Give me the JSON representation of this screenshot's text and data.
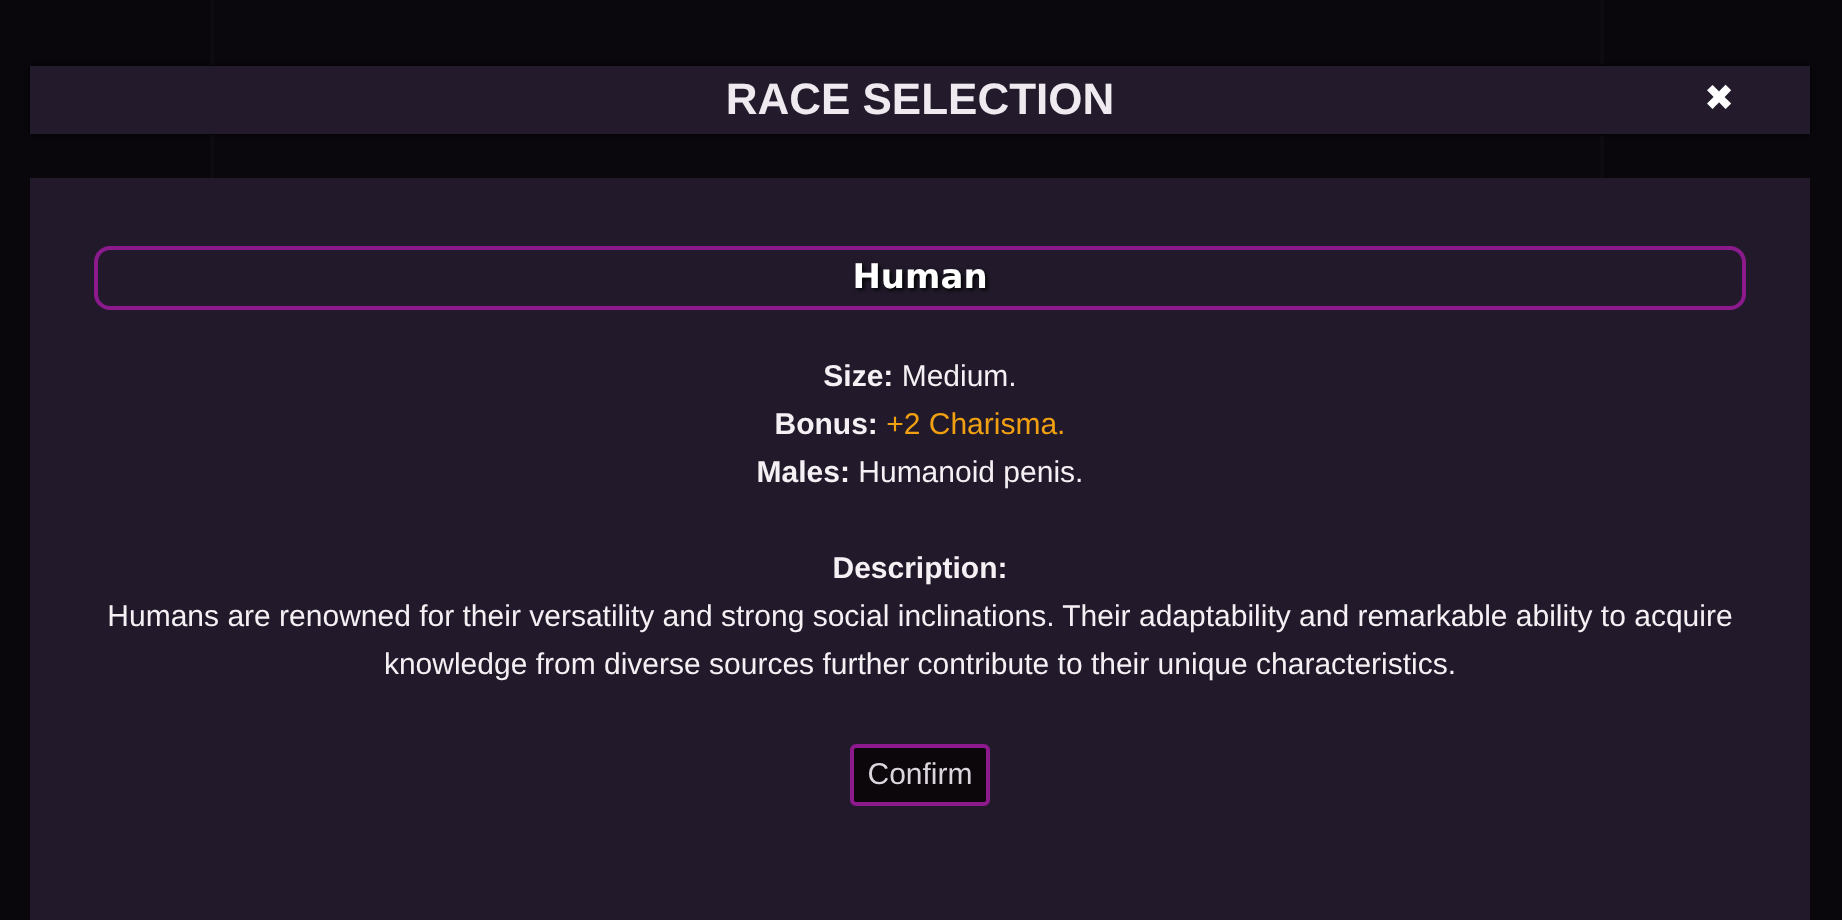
{
  "dialog": {
    "title": "RACE SELECTION",
    "close": "✖"
  },
  "race": {
    "name": "Human",
    "stats": [
      {
        "label": "Size:",
        "value": "Medium.",
        "highlight": false
      },
      {
        "label": "Bonus:",
        "value": "+2 Charisma.",
        "highlight": true
      },
      {
        "label": "Males:",
        "value": "Humanoid penis.",
        "highlight": false
      }
    ],
    "description_label": "Description:",
    "description": "Humans are renowned for their versatility and strong social inclinations. Their adaptability and remarkable ability to acquire knowledge from diverse sources further contribute to their unique characteristics."
  },
  "buttons": [
    "Confirm"
  ]
}
